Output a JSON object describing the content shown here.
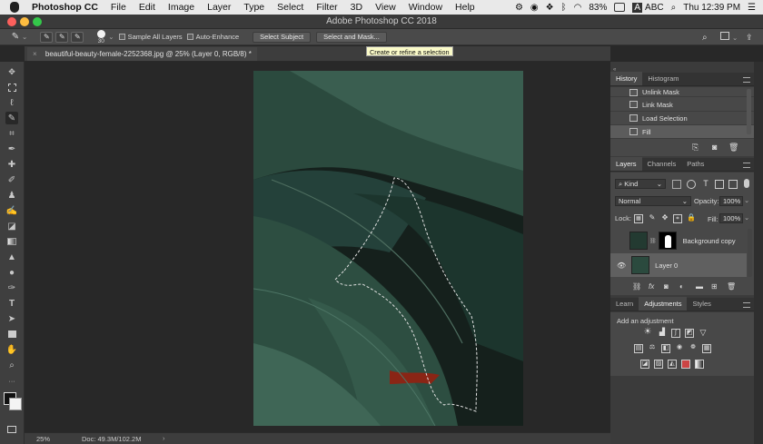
{
  "menubar": {
    "app_name": "Photoshop CC",
    "items": [
      "File",
      "Edit",
      "Image",
      "Layer",
      "Type",
      "Select",
      "Filter",
      "3D",
      "View",
      "Window",
      "Help"
    ],
    "battery": "83%",
    "input_source": "ABC",
    "input_badge": "A",
    "clock": "Thu 12:39 PM"
  },
  "window": {
    "title": "Adobe Photoshop CC 2018"
  },
  "options_bar": {
    "brush_size": "30",
    "sample_all_layers": "Sample All Layers",
    "auto_enhance": "Auto-Enhance",
    "select_subject": "Select Subject",
    "select_and_mask": "Select and Mask..."
  },
  "tooltip": {
    "text": "Create or refine a selection"
  },
  "document": {
    "tab_title": "beautiful-beauty-female-2252368.jpg @ 25% (Layer 0, RGB/8) *"
  },
  "status": {
    "zoom": "25%",
    "doc_size": "Doc: 49.3M/102.2M"
  },
  "history": {
    "tabs": [
      "History",
      "Histogram"
    ],
    "items": [
      "Unlink Mask",
      "Link Mask",
      "Load Selection",
      "Fill"
    ]
  },
  "layers": {
    "tabs": [
      "Layers",
      "Channels",
      "Paths"
    ],
    "filter_kind": "Kind",
    "blend_mode": "Normal",
    "opacity_label": "Opacity:",
    "opacity_value": "100%",
    "lock_label": "Lock:",
    "fill_label": "Fill:",
    "fill_value": "100%",
    "items": [
      "Background copy",
      "Layer 0"
    ]
  },
  "adjustments": {
    "tabs": [
      "Learn",
      "Adjustments",
      "Styles"
    ],
    "heading": "Add an adjustment"
  },
  "colors": {
    "accent": "#1473e6",
    "menubar": "#e9e9e9",
    "leaf": "#1f3a30"
  }
}
